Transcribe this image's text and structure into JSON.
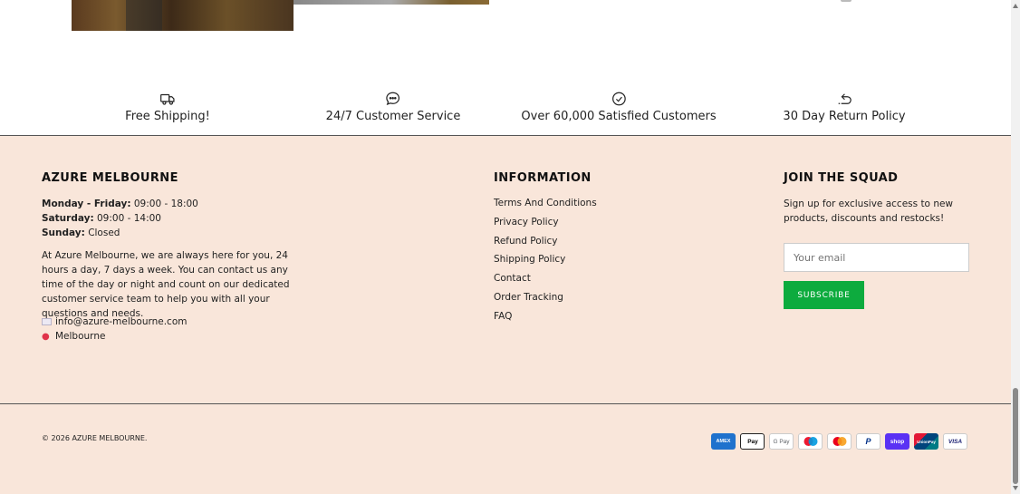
{
  "features": [
    {
      "label": "Free Shipping!",
      "icon": "truck-icon"
    },
    {
      "label": "24/7 Customer Service",
      "icon": "chat-icon"
    },
    {
      "label": "Over 60,000 Satisfied Customers",
      "icon": "check-circle-icon"
    },
    {
      "label": "30 Day Return Policy",
      "icon": "return-arrow-icon"
    }
  ],
  "store": {
    "title": "AZURE MELBOURNE",
    "hours": [
      {
        "day": "Monday - Friday:",
        "time": "09:00 - 18:00"
      },
      {
        "day": "Saturday:",
        "time": "09:00 - 14:00"
      },
      {
        "day": "Sunday:",
        "time": "Closed"
      }
    ],
    "description": "At Azure Melbourne, we are always here for you, 24 hours a day, 7 days a week. You can contact us any time of the day or night and count on our dedicated customer service team to help you with all your questions and needs.",
    "email": "info@azure-melbourne.com",
    "location": "Melbourne"
  },
  "information": {
    "title": "INFORMATION",
    "links": [
      "Terms And Conditions",
      "Privacy Policy",
      "Refund Policy",
      "Shipping Policy",
      "Contact",
      "Order Tracking",
      "FAQ"
    ]
  },
  "newsletter": {
    "title": "JOIN THE SQUAD",
    "text": "Sign up for exclusive access to new products, discounts and restocks!",
    "placeholder": "Your email",
    "button": "SUBSCRIBE"
  },
  "copyright": "© 2026 AZURE MELBOURNE.",
  "payments": [
    {
      "name": "American Express",
      "label": "AMEX",
      "bg": "#1f72cd",
      "fg": "#ffffff"
    },
    {
      "name": "Apple Pay",
      "label": "Pay",
      "bg": "#ffffff",
      "fg": "#000000"
    },
    {
      "name": "Google Pay",
      "label": "G Pay",
      "bg": "#ffffff",
      "fg": "#5f6368"
    },
    {
      "name": "Maestro",
      "label": "",
      "bg": "#ffffff",
      "fg": "#000000"
    },
    {
      "name": "Mastercard",
      "label": "",
      "bg": "#ffffff",
      "fg": "#000000"
    },
    {
      "name": "PayPal",
      "label": "P",
      "bg": "#ffffff",
      "fg": "#003087"
    },
    {
      "name": "Shop Pay",
      "label": "shop",
      "bg": "#5a31f4",
      "fg": "#ffffff"
    },
    {
      "name": "UnionPay",
      "label": "UnionPay",
      "bg": "#01798a",
      "fg": "#ffffff"
    },
    {
      "name": "Visa",
      "label": "VISA",
      "bg": "#ffffff",
      "fg": "#1a1f71"
    }
  ],
  "colors": {
    "footer_bg": "#f9e6da",
    "subscribe_bg": "#0dab3e"
  }
}
